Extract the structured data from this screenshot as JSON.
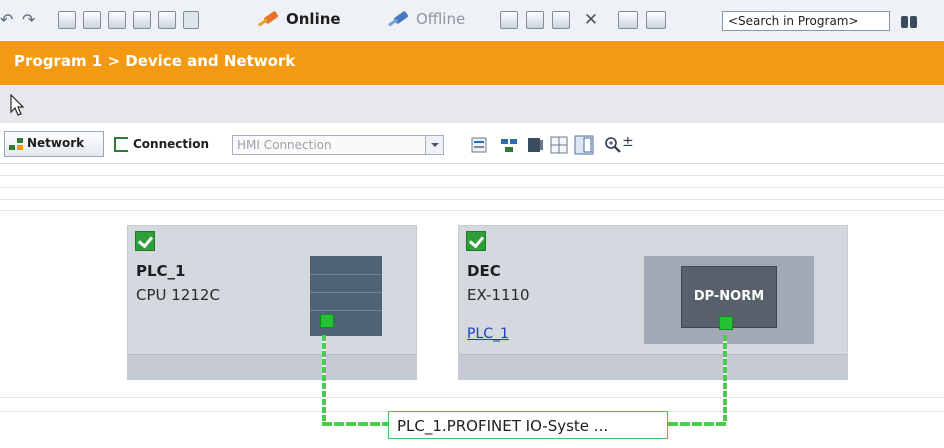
{
  "toolbar": {
    "online_label": "Online",
    "offline_label": "Offline",
    "search_placeholder": "<Search in Program>",
    "icons": [
      "undo-icon",
      "redo-icon",
      "compile-icon",
      "download-icon",
      "upload-icon",
      "save-icon",
      "monitor-icon",
      "go-online-icon",
      "go-offline-icon",
      "accessible-devices-icon",
      "start-cpu-icon",
      "stop-cpu-icon",
      "cross-reference-icon",
      "split-horizontal-icon",
      "split-vertical-icon",
      "binoculars-icon"
    ]
  },
  "breadcrumb": {
    "text": "Program 1 > Device and Network"
  },
  "view_toolbar": {
    "network_label": "Network",
    "connection_label": "Connection",
    "connection_value": "HMI Connection",
    "zoom_suffix": "±"
  },
  "devices": [
    {
      "name": "PLC_1",
      "type": "CPU 1212C",
      "status": "ok"
    },
    {
      "name": "DEC",
      "type": "EX-1110",
      "link": "PLC_1",
      "module_label": "DP-NORM",
      "status": "ok"
    }
  ],
  "network": {
    "label": "PLC_1.PROFINET IO-Syste ...",
    "line_color": "#49cc4a"
  },
  "colors": {
    "breadcrumb_bg": "#f39a12",
    "status_ok": "#2f9e3a"
  }
}
